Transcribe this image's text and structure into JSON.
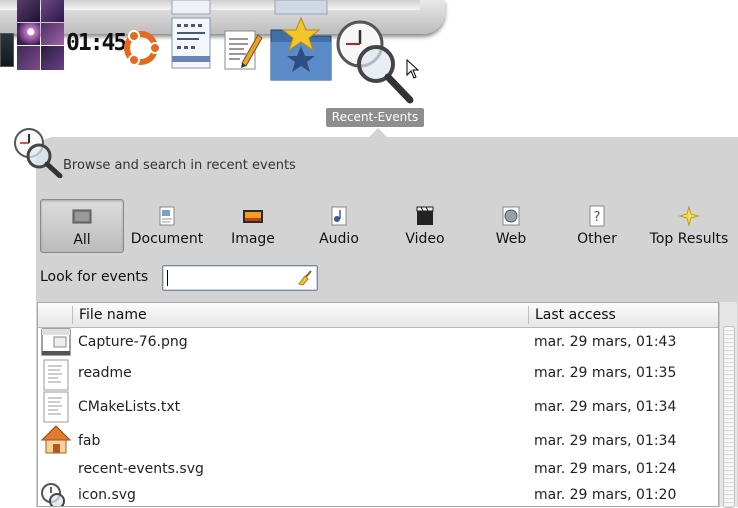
{
  "dock": {
    "clock_time": "01:45",
    "items": [
      "display-icon",
      "photo-stack-icon",
      "clock-text",
      "ubuntu-logo-icon",
      "document-icon",
      "text-editor-icon",
      "bookmarks-folder-icon",
      "recent-events-icon"
    ]
  },
  "tooltip": {
    "label": "Recent-Events"
  },
  "header": {
    "description": "Browse and search in recent events"
  },
  "filters": [
    {
      "label": "All",
      "icon": "all-icon",
      "active": true
    },
    {
      "label": "Document",
      "icon": "document-icon"
    },
    {
      "label": "Image",
      "icon": "image-icon"
    },
    {
      "label": "Audio",
      "icon": "audio-icon"
    },
    {
      "label": "Video",
      "icon": "video-icon"
    },
    {
      "label": "Web",
      "icon": "web-icon"
    },
    {
      "label": "Other",
      "icon": "other-icon"
    },
    {
      "label": "Top Results",
      "icon": "star-icon"
    }
  ],
  "search": {
    "label": "Look for events",
    "value": ""
  },
  "table": {
    "columns": [
      "File name",
      "Last access"
    ],
    "rows": [
      {
        "name": "Capture-76.png",
        "date": "mar. 29 mars, 01:43",
        "icon": "image-thumbnail-icon"
      },
      {
        "name": "readme",
        "date": "mar. 29 mars, 01:35",
        "icon": "text-file-icon"
      },
      {
        "name": "CMakeLists.txt",
        "date": "mar. 29 mars, 01:34",
        "icon": "text-file-icon"
      },
      {
        "name": "fab",
        "date": "mar. 29 mars, 01:34",
        "icon": "home-folder-icon"
      },
      {
        "name": "recent-events.svg",
        "date": "mar. 29 mars, 01:24",
        "icon": ""
      },
      {
        "name": "icon.svg",
        "date": "mar. 29 mars, 01:20",
        "icon": "clock-search-icon"
      }
    ]
  }
}
